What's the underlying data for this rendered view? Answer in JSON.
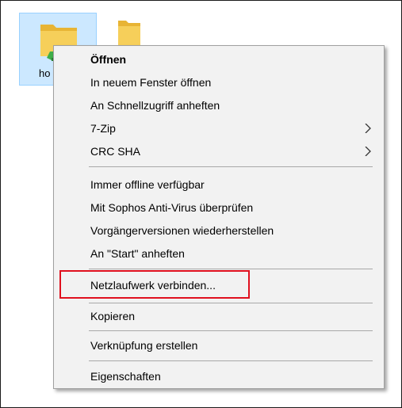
{
  "explorer": {
    "selected_folder": {
      "label_visible": "ho",
      "icon": "network-folder-icon"
    },
    "second_folder": {
      "icon": "folder-icon"
    }
  },
  "context_menu": {
    "items": [
      {
        "label": "Öffnen"
      },
      {
        "label": "In neuem Fenster öffnen"
      },
      {
        "label": "An Schnellzugriff anheften"
      },
      {
        "label": "7-Zip",
        "submenu": true
      },
      {
        "label": "CRC SHA",
        "submenu": true
      },
      {
        "label": "Immer offline verfügbar"
      },
      {
        "label": "Mit Sophos Anti-Virus überprüfen"
      },
      {
        "label": "Vorgängerversionen wiederherstellen"
      },
      {
        "label": "An \"Start\" anheften"
      },
      {
        "label": "Netzlaufwerk verbinden..."
      },
      {
        "label": "Kopieren"
      },
      {
        "label": "Verknüpfung erstellen"
      },
      {
        "label": "Eigenschaften"
      }
    ],
    "highlighted_item": "Netzlaufwerk verbinden..."
  },
  "colors": {
    "selection_bg": "#cce8ff",
    "menu_bg": "#f2f2f2",
    "highlight_border": "#e0101e",
    "folder_yellow": "#f4c542"
  }
}
